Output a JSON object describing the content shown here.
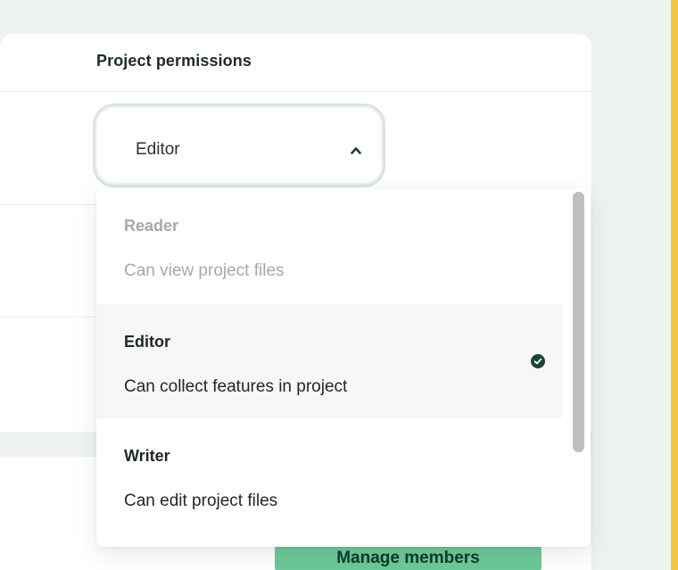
{
  "permissions": {
    "header": "Project permissions",
    "selected_value": "Editor",
    "options": [
      {
        "title": "Reader",
        "description": "Can view project files",
        "state": "disabled"
      },
      {
        "title": "Editor",
        "description": "Can collect features in project",
        "state": "selected"
      },
      {
        "title": "Writer",
        "description": "Can edit project files",
        "state": "normal"
      }
    ],
    "icons": {
      "select_toggle": "chevron-up-icon",
      "selected_marker": "check-circle-icon"
    }
  },
  "actions": {
    "manage_members_label": "Manage members"
  },
  "colors": {
    "accent_green": "#6cc99a",
    "check_green": "#1a4638",
    "frame_border": "#f5c541"
  }
}
